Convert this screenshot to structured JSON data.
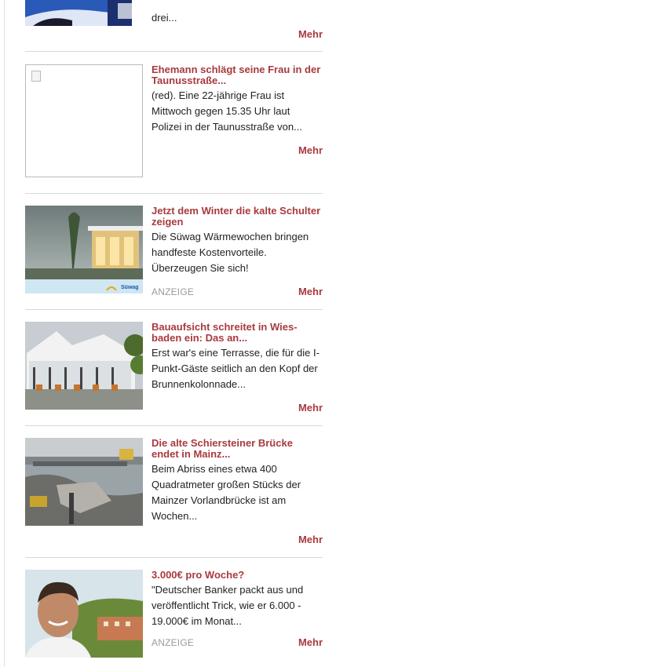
{
  "items": [
    {
      "id": "top",
      "text": "drei...",
      "more": "Mehr"
    },
    {
      "id": "ehemann",
      "title": "Ehemann schlägt seine Frau in der Taunusstraße...",
      "text": "(red). Eine 22-jährige Frau ist Mittwoch gegen 15.35 Uhr laut Polizei in der Taunusstraße von...",
      "more": "Mehr"
    },
    {
      "id": "winter",
      "title": "Jetzt dem Winter die kalte Schulter zeigen",
      "text": "Die Süwag Wärmewochen bringen handfeste Kostenvorteile. Überzeugen Sie sich!",
      "ad": "ANZEIGE",
      "brand": "Süwag",
      "more": "Mehr"
    },
    {
      "id": "bauaufsicht",
      "title": "Bauaufsicht schreitet in Wies-baden ein: Das an...",
      "text": "Erst war's eine Terrasse, die für die I-Punkt-Gäste seitlich an den Kopf der Brunnenkolonnade...",
      "more": "Mehr"
    },
    {
      "id": "bruecke",
      "title": "Die alte Schiersteiner Brücke endet in Mainz...",
      "text": "Beim Abriss eines etwa 400 Quadratmeter großen Stücks der Mainzer Vorlandbrücke ist am Wochen...",
      "more": "Mehr"
    },
    {
      "id": "banker",
      "title": "3.000€ pro Woche?",
      "text": "\"Deutscher Banker packt aus und veröffentlicht Trick, wie er 6.000 - 19.000€ im Monat...",
      "ad": "ANZEIGE",
      "more": "Mehr"
    }
  ],
  "colors": {
    "accent": "#a83a3e",
    "text": "#222222",
    "muted": "#9a9a9a",
    "divider": "#d8d8d8"
  }
}
